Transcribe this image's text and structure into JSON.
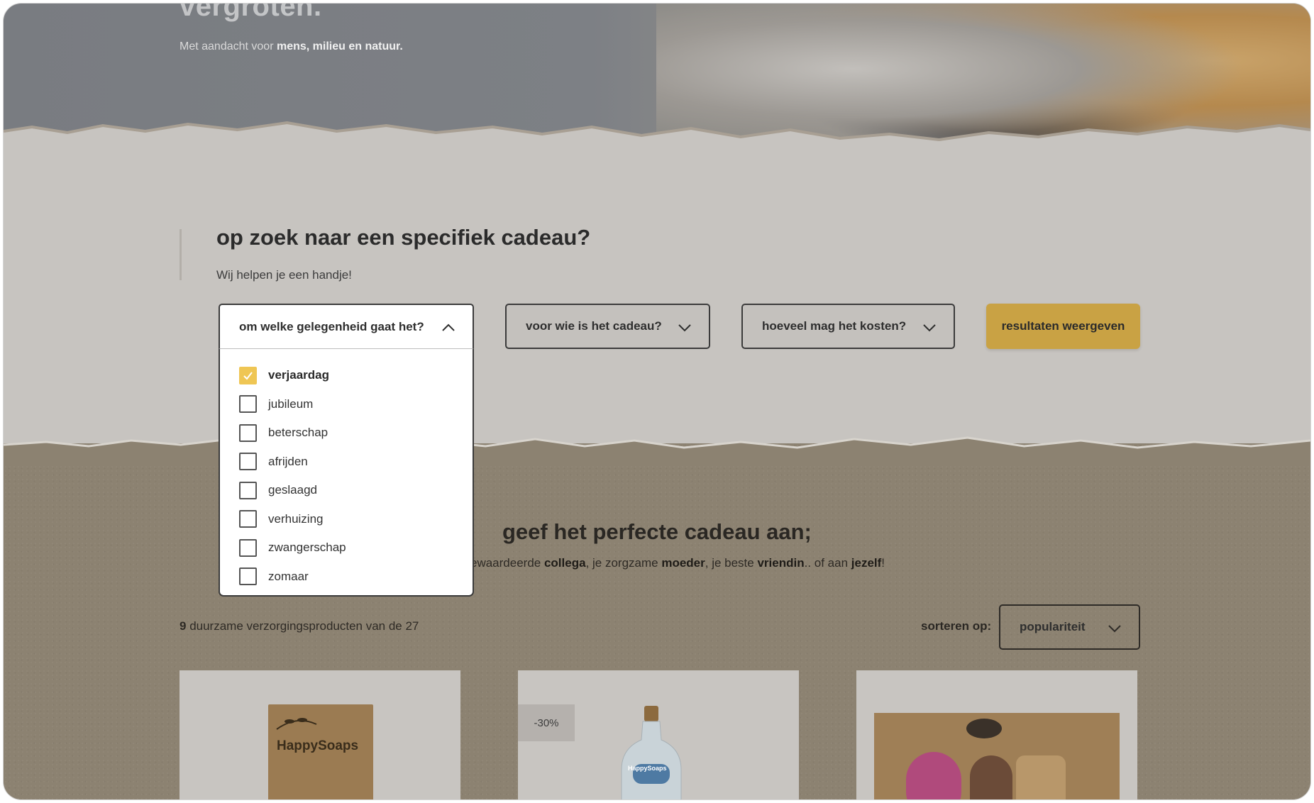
{
  "hero": {
    "heading": "vergroten.",
    "sub_prefix": "Met aandacht voor ",
    "sub_bold": "mens, milieu en natuur."
  },
  "finder": {
    "title": "op zoek naar een specifiek cadeau?",
    "subtitle": "Wij helpen je een handje!",
    "occasion_label": "om welke gelegenheid gaat het?",
    "recipient_label": "voor wie is het cadeau?",
    "budget_label": "hoeveel mag het kosten?",
    "results_button": "resultaten weergeven",
    "occasion_options": [
      {
        "label": "verjaardag",
        "checked": true
      },
      {
        "label": "jubileum",
        "checked": false
      },
      {
        "label": "beterschap",
        "checked": false
      },
      {
        "label": "afrijden",
        "checked": false
      },
      {
        "label": "geslaagd",
        "checked": false
      },
      {
        "label": "verhuizing",
        "checked": false
      },
      {
        "label": "zwangerschap",
        "checked": false
      },
      {
        "label": "zomaar",
        "checked": false
      }
    ]
  },
  "products": {
    "title": "geef het perfecte cadeau aan;",
    "sub_parts": [
      {
        "text": "ewaardeerde ",
        "bold": false
      },
      {
        "text": "collega",
        "bold": true
      },
      {
        "text": ", je zorgzame ",
        "bold": false
      },
      {
        "text": "moeder",
        "bold": true
      },
      {
        "text": ", je beste ",
        "bold": false
      },
      {
        "text": "vriendin",
        "bold": true
      },
      {
        "text": ".. of aan ",
        "bold": false
      },
      {
        "text": "jezelf",
        "bold": true
      },
      {
        "text": "!",
        "bold": false
      }
    ],
    "count_num": "9",
    "count_text": " duurzame verzorgingsproducten van de 27",
    "sort_label": "sorteren op:",
    "sort_value": "populariteit",
    "cards": [
      {
        "brand": "HappySoaps",
        "badge": ""
      },
      {
        "brand": "HappySoaps",
        "badge": "-30%"
      },
      {
        "brand": "",
        "badge": ""
      }
    ]
  },
  "colors": {
    "accent": "#c9a244",
    "check": "#efc654",
    "kraft": "#8c8271"
  }
}
